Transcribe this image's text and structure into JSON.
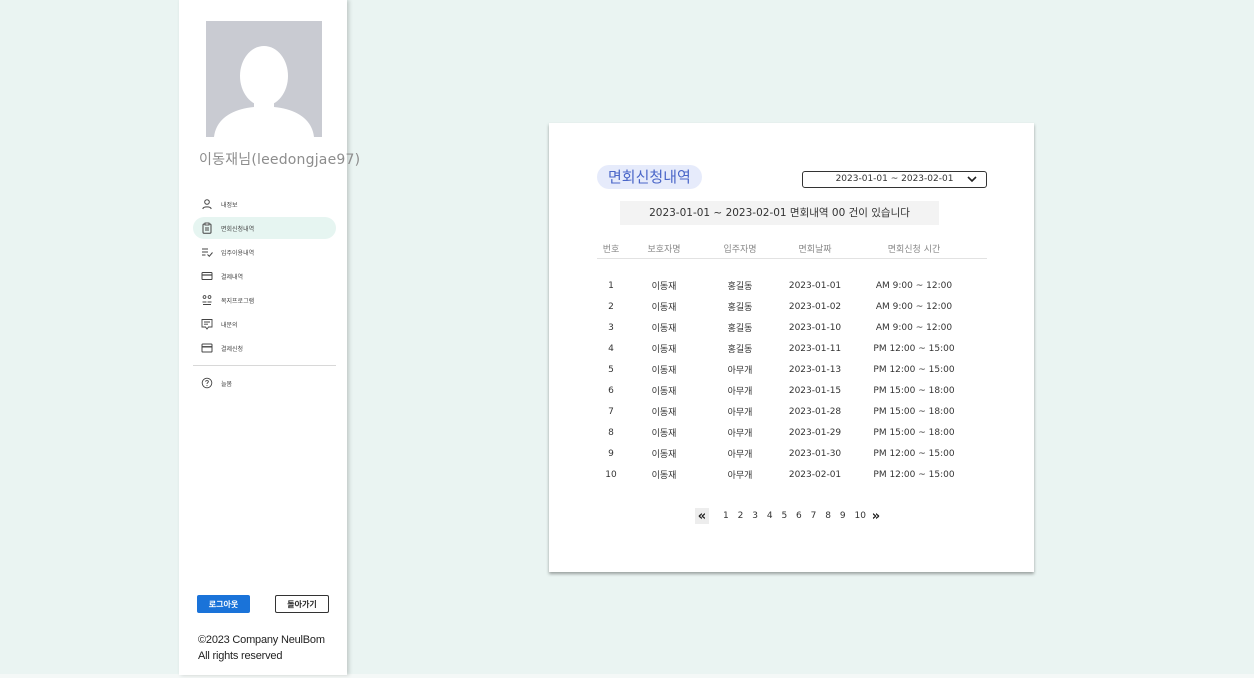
{
  "user": {
    "display_name": "이동재님",
    "user_id": "(leedongjae97)"
  },
  "sidebar": {
    "items": [
      {
        "label": "내정보",
        "icon": "person-icon"
      },
      {
        "label": "면회신청내역",
        "icon": "clipboard-icon",
        "active": true
      },
      {
        "label": "입주이용내역",
        "icon": "list-check-icon"
      },
      {
        "label": "결제내역",
        "icon": "card-icon"
      },
      {
        "label": "복지프로그램",
        "icon": "people-icon"
      },
      {
        "label": "내문의",
        "icon": "message-icon"
      },
      {
        "label": "결제신청",
        "icon": "wallet-icon"
      }
    ],
    "help": {
      "label": "늘봄",
      "icon": "help-icon"
    },
    "logout_label": "로그아웃",
    "back_label": "돌아가기",
    "copyright_line1": "©2023 Company NeulBom",
    "copyright_line2": "All rights reserved"
  },
  "main": {
    "title": "면회신청내역",
    "date_range": "2023-01-01 ~ 2023-02-01",
    "summary": "2023-01-01 ~ 2023-02-01 면회내역 00 건이 있습니다",
    "columns": [
      "번호",
      "보호자명",
      "입주자명",
      "면회날짜",
      "면회신청 시간"
    ],
    "rows": [
      [
        "1",
        "이동재",
        "홍길동",
        "2023-01-01",
        "AM 9:00 ~ 12:00"
      ],
      [
        "2",
        "이동재",
        "홍길동",
        "2023-01-02",
        "AM 9:00 ~ 12:00"
      ],
      [
        "3",
        "이동재",
        "홍길동",
        "2023-01-10",
        "AM 9:00 ~ 12:00"
      ],
      [
        "4",
        "이동재",
        "홍길동",
        "2023-01-11",
        "PM 12:00 ~ 15:00"
      ],
      [
        "5",
        "이동재",
        "아무개",
        "2023-01-13",
        "PM 12:00 ~ 15:00"
      ],
      [
        "6",
        "이동재",
        "아무개",
        "2023-01-15",
        "PM 15:00 ~ 18:00"
      ],
      [
        "7",
        "이동재",
        "아무개",
        "2023-01-28",
        "PM 15:00 ~ 18:00"
      ],
      [
        "8",
        "이동재",
        "아무개",
        "2023-01-29",
        "PM 15:00 ~ 18:00"
      ],
      [
        "9",
        "이동재",
        "아무개",
        "2023-01-30",
        "PM 12:00 ~ 15:00"
      ],
      [
        "10",
        "이동재",
        "아무개",
        "2023-02-01",
        "PM 12:00 ~ 15:00"
      ]
    ],
    "pagination": {
      "prev": "«",
      "next": "»",
      "pages": [
        "1",
        "2",
        "3",
        "4",
        "5",
        "6",
        "7",
        "8",
        "9",
        "10"
      ]
    }
  }
}
